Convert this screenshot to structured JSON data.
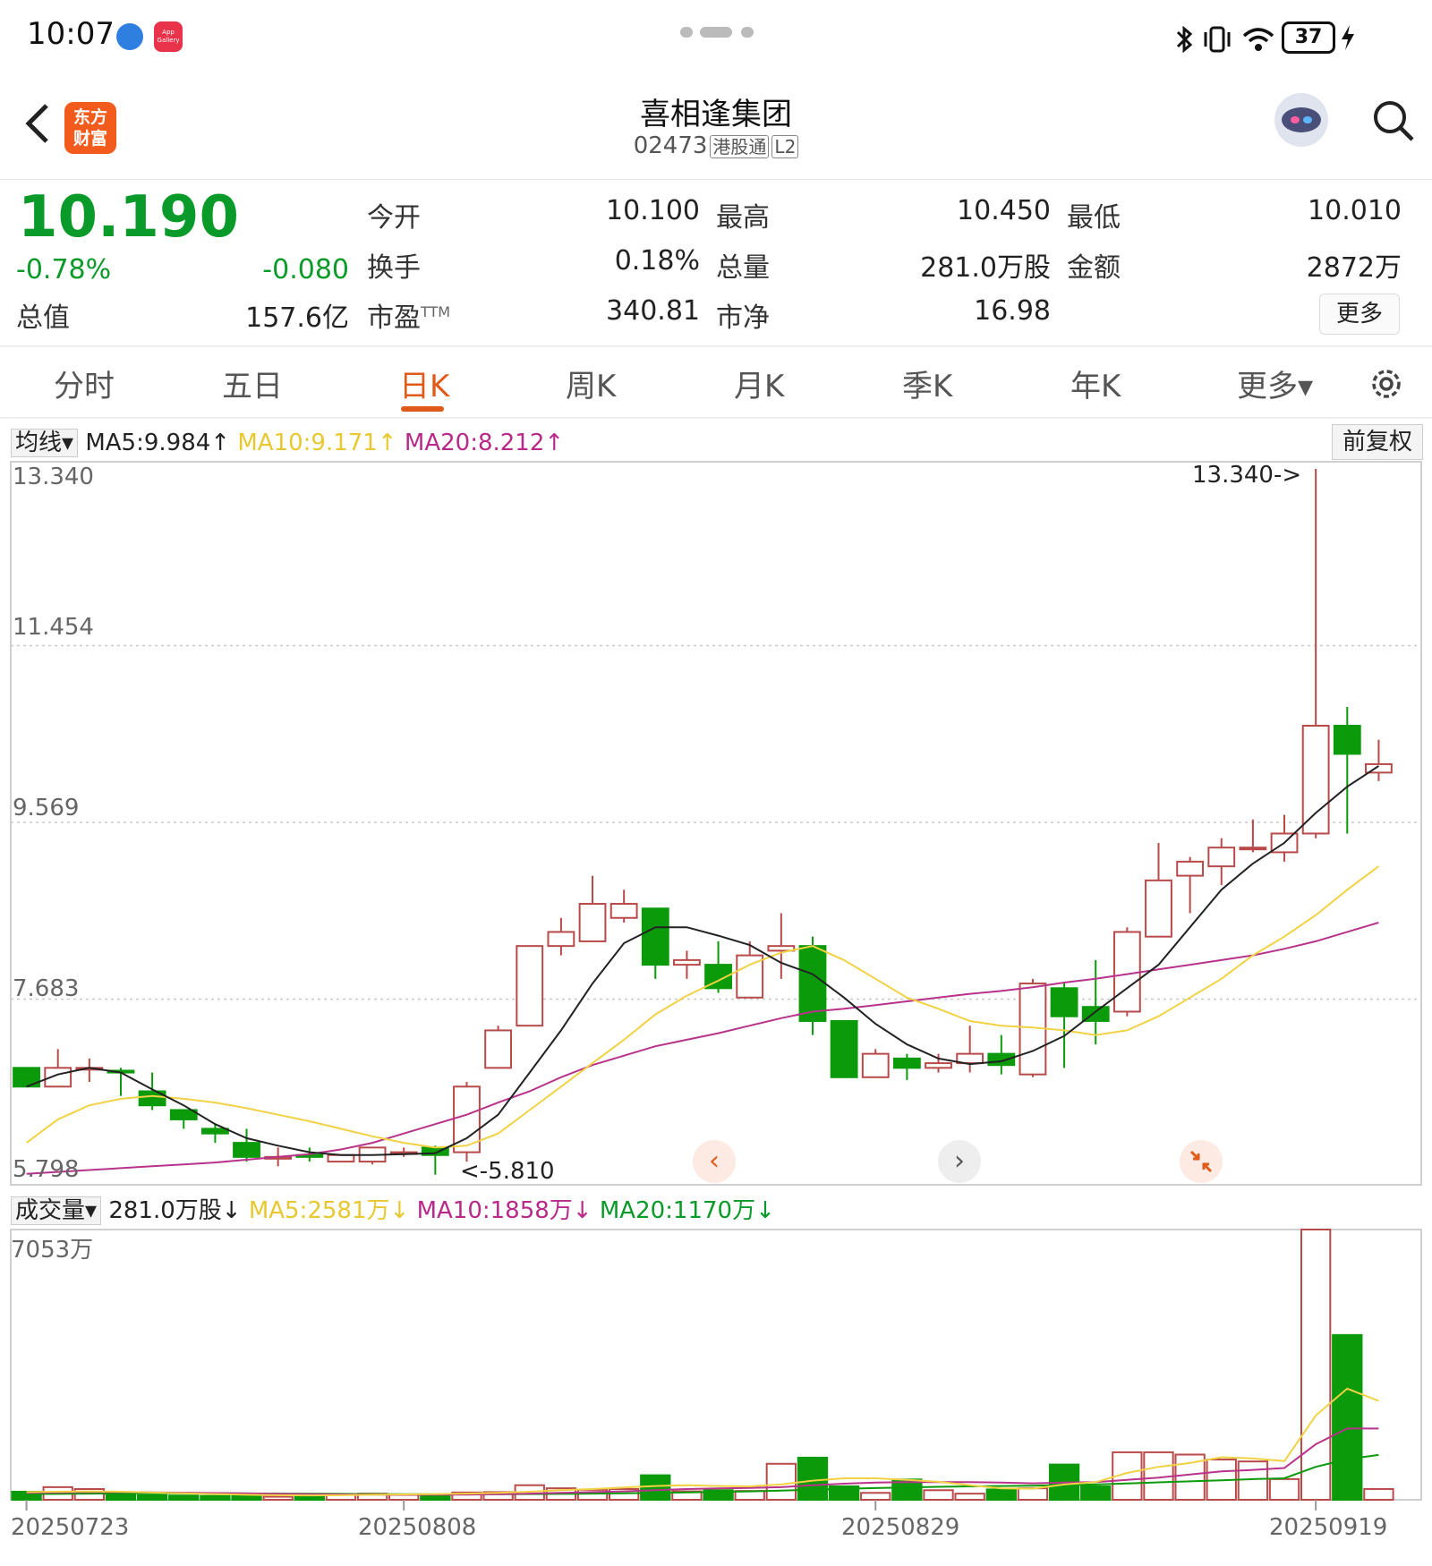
{
  "status": {
    "time": "10:07",
    "battery": "37",
    "app_gallery_label": "App Gallery"
  },
  "header": {
    "back_icon": "chevron-left-icon",
    "logo_text_1": "东方",
    "logo_text_2": "财富",
    "title": "喜相逢集团",
    "code": "02473",
    "tag1": "港股通",
    "tag2": "L2"
  },
  "quote": {
    "price": "10.190",
    "change_pct": "-0.78%",
    "change": "-0.080",
    "market_cap_label": "总值",
    "market_cap": "157.6亿",
    "open_label": "今开",
    "open": "10.100",
    "high_label": "最高",
    "high": "10.450",
    "low_label": "最低",
    "low": "10.010",
    "turnover_label": "换手",
    "turnover": "0.18%",
    "volume_label": "总量",
    "volume": "281.0万股",
    "amount_label": "金额",
    "amount": "2872万",
    "pe_label": "市盈",
    "pe_sup": "TTM",
    "pe": "340.81",
    "pb_label": "市净",
    "pb": "16.98",
    "more": "更多"
  },
  "tabs": [
    "分时",
    "五日",
    "日K",
    "周K",
    "月K",
    "季K",
    "年K",
    "更多▾"
  ],
  "active_tab": 2,
  "ma_legend": {
    "chip": "均线▾",
    "ma5": "MA5:9.984↑",
    "ma10": "MA10:9.171↑",
    "ma20": "MA20:8.212↑",
    "adjust": "前复权"
  },
  "vol_legend": {
    "chip": "成交量▾",
    "vol": "281.0万股↓",
    "ma5": "MA5:2581万↓",
    "ma10": "MA10:1858万↓",
    "ma20": "MA20:1170万↓"
  },
  "colors": {
    "up": "#b84a4a",
    "down": "#0a9a0a",
    "ma5": "#222222",
    "ma10": "#f2d244",
    "ma20": "#b8338a",
    "ma10_label": "#e8c830",
    "ma20_label": "#b82a8a",
    "vol_ma20_label": "#0a9a2a"
  },
  "chart_data": {
    "type": "candlestick",
    "price_axis_labels": [
      "13.340",
      "11.454",
      "9.569",
      "7.683",
      "5.798"
    ],
    "price_axis_values": [
      13.34,
      11.454,
      9.569,
      7.683,
      5.798
    ],
    "ylim": [
      5.798,
      13.34
    ],
    "max_annotation": "13.340->",
    "min_annotation": "<-5.810",
    "volume_axis_label": "7053万",
    "volume_max": 7053,
    "x_labels": [
      "20250723",
      "20250808",
      "20250829",
      "20250919"
    ],
    "x_label_index": [
      0,
      12,
      27,
      41
    ],
    "candles": [
      {
        "o": 6.95,
        "h": 6.95,
        "l": 6.85,
        "c": 6.75,
        "v": 210
      },
      {
        "o": 6.75,
        "h": 7.15,
        "l": 6.75,
        "c": 6.95,
        "v": 330
      },
      {
        "o": 6.95,
        "h": 7.05,
        "l": 6.8,
        "c": 6.95,
        "v": 280
      },
      {
        "o": 6.92,
        "h": 6.95,
        "l": 6.65,
        "c": 6.9,
        "v": 170
      },
      {
        "o": 6.7,
        "h": 6.9,
        "l": 6.5,
        "c": 6.55,
        "v": 120
      },
      {
        "o": 6.5,
        "h": 6.5,
        "l": 6.3,
        "c": 6.4,
        "v": 110
      },
      {
        "o": 6.3,
        "h": 6.35,
        "l": 6.15,
        "c": 6.25,
        "v": 100
      },
      {
        "o": 6.15,
        "h": 6.3,
        "l": 5.95,
        "c": 6.0,
        "v": 95
      },
      {
        "o": 6.0,
        "h": 6.1,
        "l": 5.9,
        "c": 6.0,
        "v": 80
      },
      {
        "o": 6.02,
        "h": 6.1,
        "l": 5.95,
        "c": 6.0,
        "v": 90
      },
      {
        "o": 5.95,
        "h": 6.0,
        "l": 5.95,
        "c": 6.02,
        "v": 150
      },
      {
        "o": 5.95,
        "h": 6.1,
        "l": 5.92,
        "c": 6.1,
        "v": 160
      },
      {
        "o": 6.05,
        "h": 6.1,
        "l": 6.0,
        "c": 6.05,
        "v": 130
      },
      {
        "o": 6.1,
        "h": 6.12,
        "l": 5.81,
        "c": 6.02,
        "v": 120
      },
      {
        "o": 6.05,
        "h": 6.8,
        "l": 5.95,
        "c": 6.75,
        "v": 190
      },
      {
        "o": 6.95,
        "h": 7.4,
        "l": 6.95,
        "c": 7.35,
        "v": 200
      },
      {
        "o": 7.4,
        "h": 8.25,
        "l": 7.4,
        "c": 8.25,
        "v": 380
      },
      {
        "o": 8.25,
        "h": 8.55,
        "l": 8.15,
        "c": 8.4,
        "v": 300
      },
      {
        "o": 8.3,
        "h": 9.0,
        "l": 8.3,
        "c": 8.7,
        "v": 260
      },
      {
        "o": 8.55,
        "h": 8.85,
        "l": 8.5,
        "c": 8.7,
        "v": 280
      },
      {
        "o": 8.65,
        "h": 8.65,
        "l": 7.9,
        "c": 8.05,
        "v": 640
      },
      {
        "o": 8.05,
        "h": 8.2,
        "l": 7.9,
        "c": 8.1,
        "v": 220
      },
      {
        "o": 8.05,
        "h": 8.3,
        "l": 7.75,
        "c": 7.8,
        "v": 250
      },
      {
        "o": 7.7,
        "h": 8.3,
        "l": 7.7,
        "c": 8.15,
        "v": 230
      },
      {
        "o": 8.2,
        "h": 8.6,
        "l": 7.9,
        "c": 8.25,
        "v": 940
      },
      {
        "o": 8.25,
        "h": 8.35,
        "l": 7.3,
        "c": 7.45,
        "v": 1100
      },
      {
        "o": 7.45,
        "h": 7.45,
        "l": 6.85,
        "c": 6.85,
        "v": 350
      },
      {
        "o": 6.85,
        "h": 7.15,
        "l": 6.85,
        "c": 7.1,
        "v": 180
      },
      {
        "o": 7.05,
        "h": 7.1,
        "l": 6.82,
        "c": 6.95,
        "v": 530
      },
      {
        "o": 6.95,
        "h": 7.1,
        "l": 6.9,
        "c": 7.0,
        "v": 250
      },
      {
        "o": 7.0,
        "h": 7.4,
        "l": 6.9,
        "c": 7.1,
        "v": 160
      },
      {
        "o": 7.1,
        "h": 7.3,
        "l": 6.88,
        "c": 6.98,
        "v": 270
      },
      {
        "o": 6.88,
        "h": 7.9,
        "l": 6.85,
        "c": 7.85,
        "v": 300
      },
      {
        "o": 7.8,
        "h": 7.85,
        "l": 6.95,
        "c": 7.5,
        "v": 920
      },
      {
        "o": 7.6,
        "h": 8.1,
        "l": 7.2,
        "c": 7.45,
        "v": 350
      },
      {
        "o": 7.55,
        "h": 8.45,
        "l": 7.5,
        "c": 8.4,
        "v": 1240
      },
      {
        "o": 8.35,
        "h": 9.35,
        "l": 8.35,
        "c": 8.95,
        "v": 1240
      },
      {
        "o": 9.0,
        "h": 9.2,
        "l": 8.6,
        "c": 9.15,
        "v": 1180
      },
      {
        "o": 9.1,
        "h": 9.4,
        "l": 8.9,
        "c": 9.3,
        "v": 1050
      },
      {
        "o": 9.3,
        "h": 9.6,
        "l": 9.25,
        "c": 9.3,
        "v": 1000
      },
      {
        "o": 9.25,
        "h": 9.65,
        "l": 9.15,
        "c": 9.45,
        "v": 540
      },
      {
        "o": 9.45,
        "h": 13.34,
        "l": 9.4,
        "c": 10.6,
        "v": 7053
      },
      {
        "o": 10.6,
        "h": 10.8,
        "l": 9.45,
        "c": 10.3,
        "v": 4300
      },
      {
        "o": 10.1,
        "h": 10.45,
        "l": 10.01,
        "c": 10.19,
        "v": 281
      }
    ],
    "ma5": [
      6.75,
      6.88,
      6.95,
      6.9,
      6.72,
      6.55,
      6.35,
      6.2,
      6.12,
      6.05,
      6.02,
      6.02,
      6.03,
      6.04,
      6.2,
      6.45,
      6.9,
      7.35,
      7.85,
      8.28,
      8.45,
      8.45,
      8.36,
      8.26,
      8.07,
      7.95,
      7.7,
      7.42,
      7.2,
      7.05,
      6.99,
      7.02,
      7.13,
      7.29,
      7.55,
      7.8,
      8.05,
      8.45,
      8.85,
      9.13,
      9.35,
      9.67,
      9.95,
      10.17
    ],
    "ma10": [
      6.15,
      6.4,
      6.55,
      6.62,
      6.65,
      6.62,
      6.58,
      6.52,
      6.45,
      6.38,
      6.3,
      6.22,
      6.15,
      6.1,
      6.12,
      6.25,
      6.5,
      6.75,
      7.0,
      7.25,
      7.52,
      7.72,
      7.88,
      8.05,
      8.18,
      8.25,
      8.1,
      7.9,
      7.7,
      7.58,
      7.45,
      7.4,
      7.38,
      7.35,
      7.3,
      7.35,
      7.5,
      7.7,
      7.9,
      8.15,
      8.35,
      8.58,
      8.85,
      9.1
    ],
    "ma20": [
      5.82,
      5.84,
      5.86,
      5.88,
      5.9,
      5.92,
      5.94,
      5.97,
      6.0,
      6.03,
      6.08,
      6.15,
      6.25,
      6.35,
      6.45,
      6.58,
      6.7,
      6.85,
      6.98,
      7.08,
      7.18,
      7.25,
      7.32,
      7.4,
      7.48,
      7.55,
      7.58,
      7.62,
      7.66,
      7.7,
      7.74,
      7.77,
      7.81,
      7.86,
      7.9,
      7.95,
      8.0,
      8.05,
      8.1,
      8.15,
      8.22,
      8.3,
      8.4,
      8.5
    ],
    "vol_ma5": [
      200,
      210,
      220,
      210,
      190,
      170,
      150,
      130,
      120,
      115,
      120,
      130,
      140,
      150,
      160,
      180,
      210,
      250,
      280,
      320,
      360,
      380,
      360,
      350,
      400,
      500,
      560,
      560,
      520,
      470,
      380,
      300,
      290,
      400,
      460,
      700,
      860,
      960,
      1110,
      1080,
      1010,
      2200,
      2900,
      2581
    ],
    "vol_ma10": [
      180,
      190,
      200,
      200,
      195,
      185,
      175,
      165,
      155,
      145,
      140,
      135,
      130,
      130,
      135,
      145,
      160,
      180,
      200,
      220,
      250,
      280,
      300,
      310,
      330,
      380,
      420,
      450,
      460,
      460,
      460,
      450,
      430,
      450,
      460,
      520,
      580,
      660,
      740,
      780,
      830,
      1450,
      1860,
      1858
    ],
    "vol_ma20": [
      150,
      155,
      160,
      165,
      170,
      170,
      168,
      165,
      160,
      158,
      155,
      150,
      148,
      146,
      146,
      148,
      150,
      155,
      162,
      170,
      180,
      192,
      205,
      220,
      240,
      262,
      285,
      305,
      322,
      338,
      350,
      360,
      370,
      385,
      400,
      425,
      455,
      480,
      510,
      540,
      560,
      860,
      1060,
      1170
    ]
  }
}
